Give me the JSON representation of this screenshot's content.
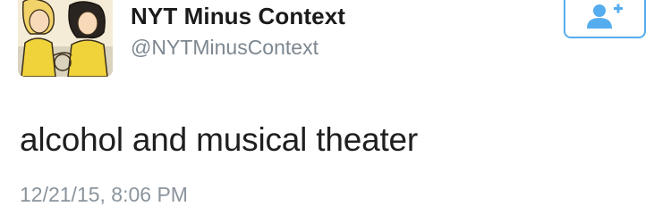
{
  "tweet": {
    "display_name": "NYT Minus Context",
    "handle": "@NYTMinusContext",
    "text": "alcohol and musical theater",
    "timestamp": "12/21/15, 8:06 PM"
  },
  "follow_button": {
    "icon": "follow-user-icon",
    "color": "#55acee"
  },
  "colors": {
    "name": "#1b1b1b",
    "secondary": "#7d8790",
    "accent": "#55acee"
  }
}
